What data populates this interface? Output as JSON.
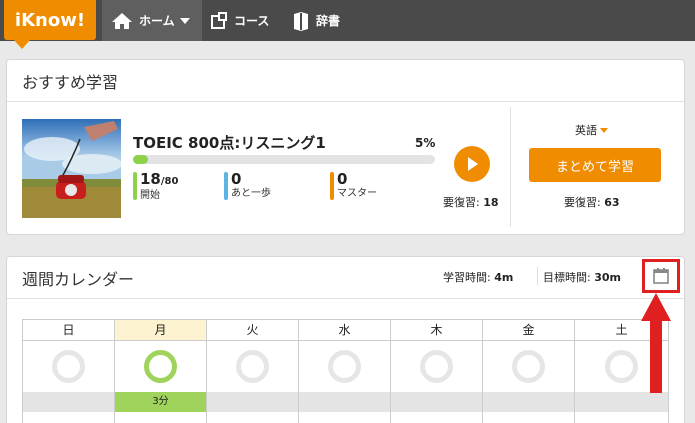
{
  "header": {
    "logo": "iKnow!",
    "nav": [
      {
        "label": "ホーム",
        "icon": "home-icon"
      },
      {
        "label": "コース",
        "icon": "course-icon"
      },
      {
        "label": "辞書",
        "icon": "book-icon"
      }
    ]
  },
  "recommended": {
    "title": "おすすめ学習",
    "course": {
      "name": "TOEIC 800点:リスニング1",
      "progress_label": "5%",
      "progress": 0.05,
      "stats": [
        {
          "count": "18",
          "total": "/80",
          "label": "開始",
          "color": "#8ed14b"
        },
        {
          "count": "0",
          "total": "",
          "label": "あと一歩",
          "color": "#5bb4e5"
        },
        {
          "count": "0",
          "total": "",
          "label": "マスター",
          "color": "#f08c00"
        }
      ],
      "review_label": "要復習:",
      "review_count": "18"
    },
    "language": "英語",
    "batch_button": "まとめて学習",
    "batch_review_label": "要復習:",
    "batch_review_count": "63"
  },
  "calendar": {
    "title": "週間カレンダー",
    "study_time_label": "学習時間:",
    "study_time": "4m",
    "goal_time_label": "目標時間:",
    "goal_time": "30m",
    "days": [
      {
        "label": "日",
        "done": false,
        "time": ""
      },
      {
        "label": "月",
        "done": true,
        "time": "3分"
      },
      {
        "label": "火",
        "done": false,
        "time": ""
      },
      {
        "label": "水",
        "done": false,
        "time": ""
      },
      {
        "label": "木",
        "done": false,
        "time": ""
      },
      {
        "label": "金",
        "done": false,
        "time": ""
      },
      {
        "label": "土",
        "done": false,
        "time": ""
      }
    ]
  },
  "colors": {
    "accent": "#f08c00",
    "nav_bg": "#4a4a4a",
    "highlight": "#e02020"
  }
}
